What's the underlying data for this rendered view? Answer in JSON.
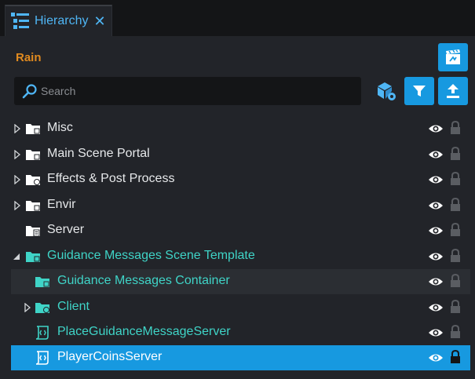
{
  "tab": {
    "title": "Hierarchy",
    "close": "✕",
    "icon": "hierarchy-list-icon"
  },
  "header": {
    "project_name": "Rain"
  },
  "search": {
    "placeholder": "Search",
    "value": ""
  },
  "toolbar": {
    "scene_button_icon": "clapperboard-icon",
    "cube_icon": "cube-settings-icon",
    "filter_icon": "filter-icon",
    "upload_icon": "upload-icon"
  },
  "colors": {
    "accent": "#1799e0",
    "teal": "#3fd4c7",
    "orange": "#e08a1f"
  },
  "tree": [
    {
      "label": "Misc",
      "expander": "collapsed",
      "icon": "folder-icon",
      "teal": false
    },
    {
      "label": "Main Scene Portal",
      "expander": "collapsed",
      "icon": "folder-icon",
      "teal": false
    },
    {
      "label": "Effects & Post Process",
      "expander": "collapsed",
      "icon": "folder-pin-icon",
      "teal": false
    },
    {
      "label": "Envir",
      "expander": "collapsed",
      "icon": "folder-icon",
      "teal": false
    },
    {
      "label": "Server",
      "expander": "none",
      "icon": "server-folder-icon",
      "teal": false
    },
    {
      "label": "Guidance Messages Scene Template",
      "expander": "expanded",
      "icon": "template-folder-icon",
      "teal": true
    },
    {
      "label": "Guidance Messages Container",
      "expander": "none",
      "icon": "template-folder-icon",
      "teal": true
    },
    {
      "label": "Client",
      "expander": "collapsed",
      "icon": "client-folder-icon",
      "teal": true
    },
    {
      "label": "PlaceGuidanceMessageServer",
      "expander": "none",
      "icon": "script-icon",
      "teal": true
    },
    {
      "label": "PlayerCoinsServer",
      "expander": "none",
      "icon": "script-icon",
      "teal": false,
      "selected": true
    }
  ]
}
